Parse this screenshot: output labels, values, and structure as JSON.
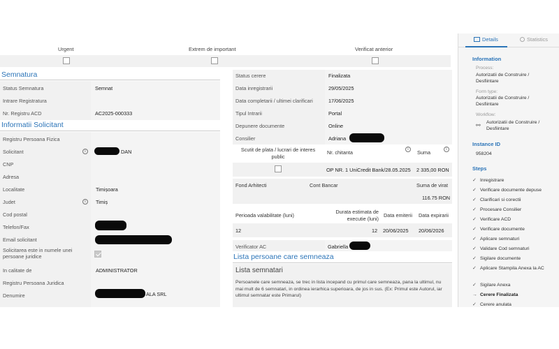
{
  "top_flags": {
    "urgent": "Urgent",
    "extrem": "Extrem de important",
    "verificat": "Verificat anterior"
  },
  "semnatura": {
    "title": "Semnatura",
    "rows": [
      {
        "label": "Status Semnatura",
        "value": "Semnat"
      },
      {
        "label": "Intrare Registratura",
        "value": ""
      },
      {
        "label": "Nr. Registru ACD",
        "value": "AC2025-000333"
      }
    ]
  },
  "solicitant": {
    "title": "Informatii Solicitant",
    "registru_pf": "Registru Persoana Fizica",
    "solicitant_label": "Solicitant",
    "solicitant_value": "DAN",
    "cnp": "CNP",
    "adresa": "Adresa",
    "localitate_label": "Localitate",
    "localitate_value": "Timișoara",
    "judet_label": "Judet",
    "judet_value": "Timiș",
    "cod_postal": "Cod postal",
    "telefon": "Telefon/Fax",
    "email": "Email solicitant",
    "pj_question": "Solicitarea este in numele unei persoane juridice",
    "calitate_label": "In calitate de",
    "calitate_value": "ADMINISTRATOR",
    "registru_pj": "Registru Persoana Juridica",
    "denumire_label": "Denumire",
    "denumire_value": "ALA SRL"
  },
  "cerere": {
    "rows": [
      {
        "label": "Status cerere",
        "value": "Finalizata"
      },
      {
        "label": "Data inregistrarii",
        "value": "29/05/2025"
      },
      {
        "label": "Data completarii / ultimei clarificari",
        "value": "17/06/2025"
      },
      {
        "label": "Tipul Intrarii",
        "value": "Portal"
      },
      {
        "label": "Depunere documente",
        "value": "Online"
      },
      {
        "label": "Consilier",
        "value": "Adriana"
      }
    ]
  },
  "plata": {
    "scutit_header": "Scutit de plata / lucrari de interes public",
    "chitanta_header": "Nr. chitanta",
    "suma_header": "Suma",
    "chitanta_value": "OP NR. 1 UniCredit Bank/28.05.2025",
    "suma_value": "2 335,00 RON"
  },
  "fond": {
    "fond_label": "Fond Arhitecti",
    "cont_label": "Cont Bancar",
    "suma_label": "Suma de virat",
    "suma_value": "116.75 RON"
  },
  "perioada": {
    "valabilitate_label": "Perioada valabilitate (luni)",
    "durata_label": "Durata estimata de executie (luni)",
    "emiterii_label": "Data emiterii",
    "expirarii_label": "Data expirarii",
    "valabilitate_value": "12",
    "durata_value": "12",
    "emiterii_value": "20/06/2025",
    "expirarii_value": "20/06/2026"
  },
  "verificator": {
    "label": "Verificator AC",
    "value": "Gabriella"
  },
  "lista": {
    "title": "Lista persoane care semneaza",
    "subtitle": "Lista semnatari",
    "note": "Persoanele care semneaza, se trec in lista incepand cu primul care semneaza, pana la ultimul, nu mai mult de 6 semnatari, in ordinea ierarhica superioara, de jos in sus. (Ex: Primul este Autorul, iar ultimul semnatar este Primarul)"
  },
  "sidebar": {
    "tab_details": "Details",
    "tab_statistics": "Statistics",
    "information_title": "Information",
    "process_label": "Process:",
    "process_value": "Autorizatii de Construire / Desfiintare",
    "formtype_label": "Form type:",
    "formtype_value": "Autorizatii de Construire / Desfiintare",
    "workflow_label": "Workflow:",
    "workflow_value": "Autorizatii de Construire / Desfiintare",
    "instance_title": "Instance ID",
    "instance_value": "958204",
    "steps_title": "Steps",
    "steps": [
      "Inregistrare",
      "Verificare documente depuse",
      "Clarificari si corectii",
      "Procesare Consilier",
      "Verificare ACD",
      "Verificare documente",
      "Aplicare semnaturi",
      "Validare Cod semnaturi",
      "Sigilare documente",
      "Aplicare Stampila Anexa la AC",
      "Sigilare Anexa",
      "Cerere Finalizata",
      "Cerere anulata"
    ]
  }
}
